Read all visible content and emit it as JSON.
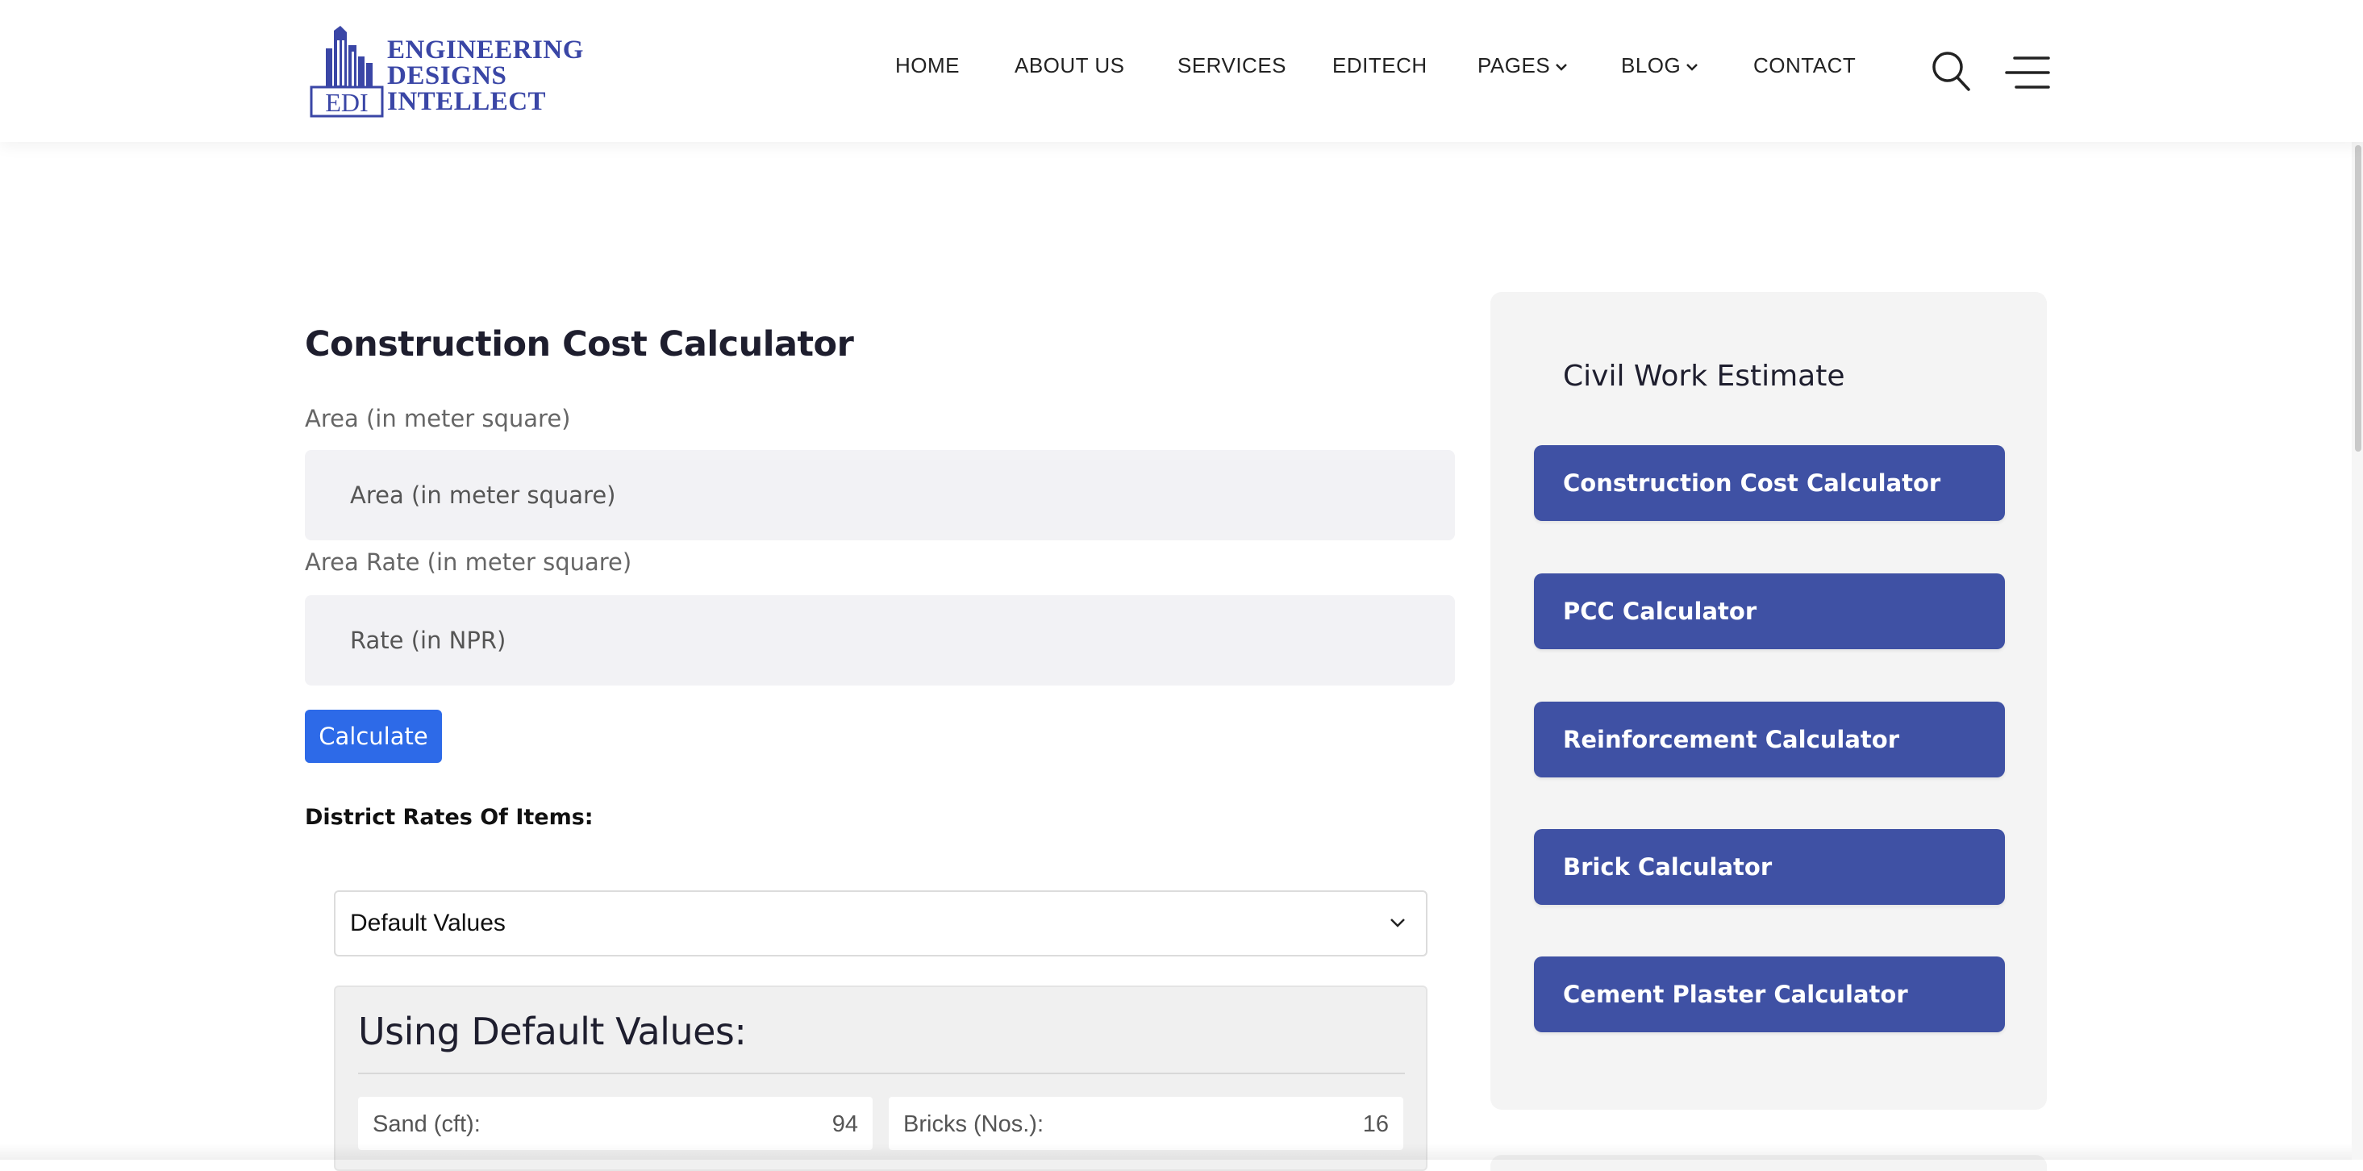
{
  "header": {
    "logo": {
      "monogram": "EDI",
      "lines": [
        "ENGINEERING",
        "DESIGNS",
        "INTELLECT"
      ],
      "color": "#3a46a6"
    },
    "nav": [
      {
        "label": "HOME"
      },
      {
        "label": "ABOUT US"
      },
      {
        "label": "SERVICES"
      },
      {
        "label": "EDITECH"
      },
      {
        "label": "PAGES",
        "dropdown": true
      },
      {
        "label": "BLOG",
        "dropdown": true
      },
      {
        "label": "CONTACT"
      }
    ],
    "icons": [
      "search-icon",
      "hamburger-menu-icon"
    ]
  },
  "form": {
    "title": "Construction Cost Calculator",
    "area_label": "Area (in meter square)",
    "area_placeholder": "Area (in meter square)",
    "rate_label": "Area Rate (in meter square)",
    "rate_placeholder": "Rate (in NPR)",
    "calculate_label": "Calculate",
    "district_label": "District Rates Of Items:",
    "district_select": {
      "selected": "Default Values"
    },
    "defaults": {
      "title": "Using Default Values:",
      "items": [
        {
          "label": "Sand (cft):",
          "value": "94"
        },
        {
          "label": "Bricks (Nos.):",
          "value": "16"
        }
      ]
    }
  },
  "sidebar": {
    "title": "Civil Work Estimate",
    "items": [
      {
        "label": "Construction Cost Calculator"
      },
      {
        "label": "PCC Calculator"
      },
      {
        "label": "Reinforcement Calculator"
      },
      {
        "label": "Brick Calculator"
      },
      {
        "label": "Cement Plaster Calculator"
      }
    ],
    "button_color": "#3f51a4"
  },
  "colors": {
    "primary_button": "#2d6ae8",
    "input_background": "#f2f2f5"
  }
}
